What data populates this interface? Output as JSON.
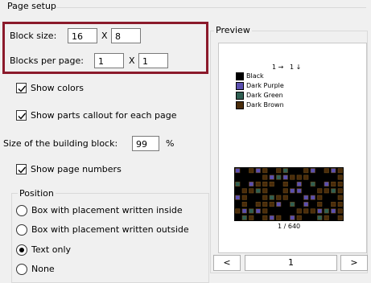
{
  "page_setup": {
    "title": "Page setup",
    "block_size": {
      "label": "Block size:",
      "w": "16",
      "sep": "X",
      "h": "8"
    },
    "blocks_per_page": {
      "label": "Blocks per page:",
      "w": "1",
      "sep": "X",
      "h": "1"
    },
    "show_colors": {
      "label": "Show colors",
      "checked": true
    },
    "show_parts_callout": {
      "label": "Show parts callout for each page",
      "checked": true
    },
    "building_block_size": {
      "label": "Size of the building block:",
      "value": "99",
      "unit": "%"
    },
    "show_page_numbers": {
      "label": "Show page numbers",
      "checked": true
    },
    "position": {
      "title": "Position",
      "options": [
        {
          "label": "Box with placement written inside",
          "selected": false
        },
        {
          "label": "Box with placement written outside",
          "selected": false
        },
        {
          "label": "Text only",
          "selected": true
        },
        {
          "label": "None",
          "selected": false
        }
      ]
    }
  },
  "preview": {
    "title": "Preview",
    "arrows_label": "1 →   1 ↓",
    "legend": [
      {
        "name": "Black",
        "color": "#000000"
      },
      {
        "name": "Dark Purple",
        "color": "#5a4fb0"
      },
      {
        "name": "Dark Green",
        "color": "#2f5f52"
      },
      {
        "name": "Dark Brown",
        "color": "#4a2c0a"
      }
    ],
    "page_label": "1 / 640",
    "nav": {
      "prev": "<",
      "page_value": "1",
      "next": ">"
    }
  },
  "colors": {
    "highlight": "#8b1a2b"
  }
}
